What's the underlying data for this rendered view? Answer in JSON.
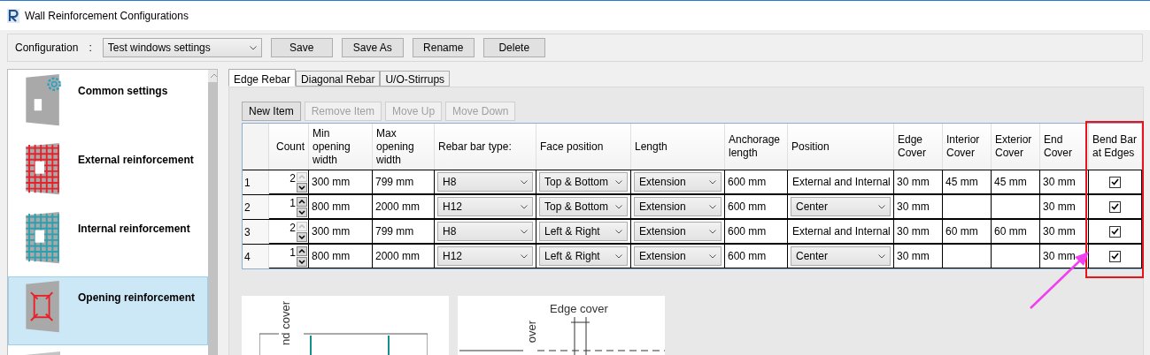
{
  "window": {
    "title": "Wall Reinforcement Configurations"
  },
  "configuration": {
    "label": "Configuration",
    "separator": ":",
    "value": "Test windows settings",
    "buttons": [
      "Save",
      "Save As",
      "Rename",
      "Delete"
    ]
  },
  "sidebar": {
    "items": [
      {
        "label": "Common settings",
        "kind": "common",
        "selected": false
      },
      {
        "label": "External reinforcement",
        "kind": "external",
        "selected": false
      },
      {
        "label": "Internal reinforcement",
        "kind": "internal",
        "selected": false
      },
      {
        "label": "Opening reinforcement",
        "kind": "opening",
        "selected": true
      },
      {
        "kind": "partial",
        "selected": false
      }
    ]
  },
  "tabs": [
    {
      "label": "Edge Rebar",
      "selected": true
    },
    {
      "label": "Diagonal Rebar",
      "selected": false
    },
    {
      "label": "U/O-Stirrups",
      "selected": false
    }
  ],
  "table_buttons": [
    {
      "label": "New Item",
      "disabled": false
    },
    {
      "label": "Remove Item",
      "disabled": true
    },
    {
      "label": "Move Up",
      "disabled": true
    },
    {
      "label": "Move Down",
      "disabled": true
    }
  ],
  "table": {
    "columns": [
      "Count",
      "Min opening width",
      "Max opening width",
      "Rebar bar type:",
      "Face position",
      "Length",
      "Anchorage length",
      "Position",
      "Edge Cover",
      "Interior Cover",
      "Exterior Cover",
      "End Cover",
      "Bend Bar at Edges"
    ],
    "rows": [
      {
        "index": "1",
        "count": "2",
        "up_disabled": true,
        "min": "300 mm",
        "max": "799 mm",
        "bar_type": "H8",
        "face": "Top & Bottom",
        "length": "Extension",
        "anchorage": "600 mm",
        "position": {
          "kind": "text",
          "value": "External and Internal"
        },
        "edge": "30 mm",
        "interior": "45 mm",
        "exterior": "45 mm",
        "end": "30 mm",
        "bend": true
      },
      {
        "index": "2",
        "count": "1",
        "up_disabled": false,
        "min": "800 mm",
        "max": "2000 mm",
        "bar_type": "H12",
        "face": "Top & Bottom",
        "length": "Extension",
        "anchorage": "600 mm",
        "position": {
          "kind": "dropdown",
          "value": "Center"
        },
        "edge": "30 mm",
        "end": "30 mm",
        "bend": true
      },
      {
        "index": "3",
        "count": "2",
        "up_disabled": true,
        "min": "300 mm",
        "max": "799 mm",
        "bar_type": "H8",
        "face": "Left & Right",
        "length": "Extension",
        "anchorage": "600 mm",
        "position": {
          "kind": "text",
          "value": "External and Internal"
        },
        "edge": "30 mm",
        "interior": "60 mm",
        "exterior": "60 mm",
        "end": "30 mm",
        "bend": true
      },
      {
        "index": "4",
        "count": "1",
        "up_disabled": false,
        "min": "800 mm",
        "max": "2000 mm",
        "bar_type": "H12",
        "face": "Left & Right",
        "length": "Extension",
        "anchorage": "600 mm",
        "position": {
          "kind": "dropdown",
          "value": "Center"
        },
        "edge": "30 mm",
        "end": "30 mm",
        "bend": true
      }
    ]
  },
  "diagrams": [
    {
      "labels": [
        "nd cover"
      ]
    },
    {
      "labels": [
        "Edge cover",
        "over"
      ]
    }
  ]
}
